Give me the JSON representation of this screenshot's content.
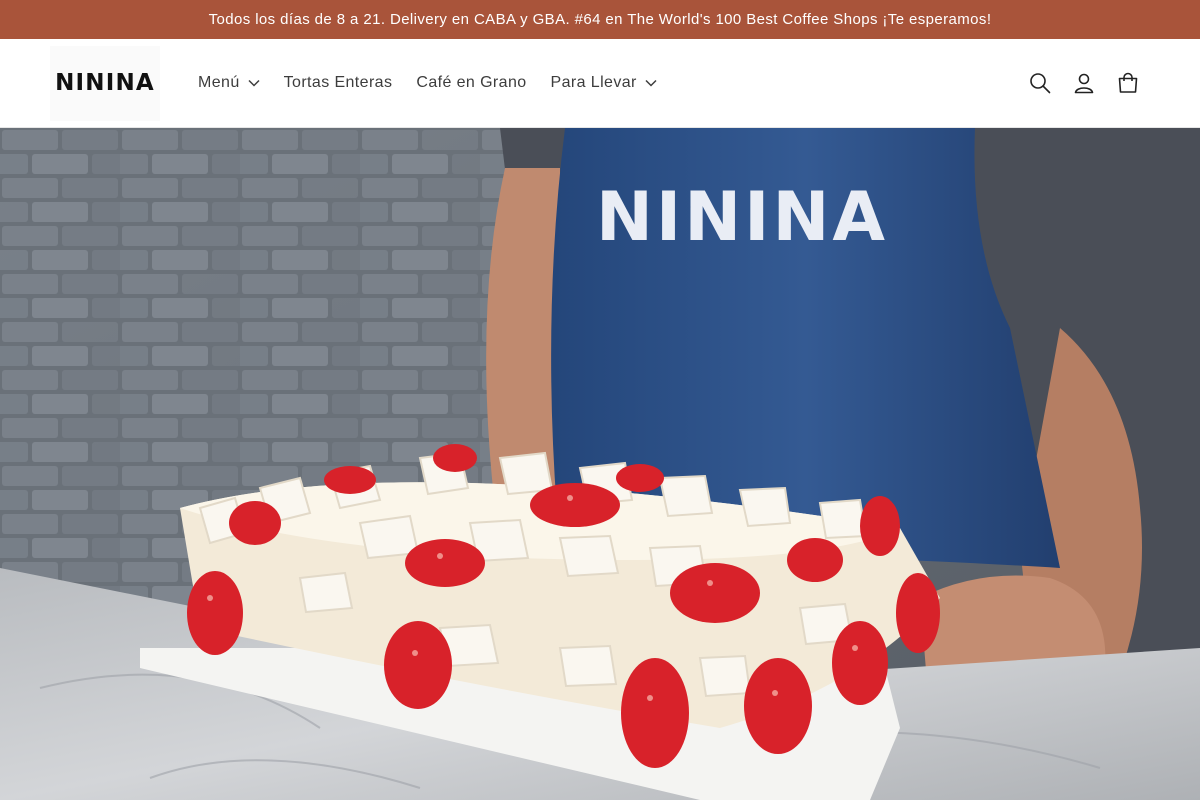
{
  "announcement": {
    "text": "Todos los días de 8 a 21. Delivery en CABA y GBA. #64 en The World's 100 Best Coffee Shops ¡Te esperamos!"
  },
  "header": {
    "logo_text": "NININA",
    "nav": [
      {
        "label": "Menú",
        "has_dropdown": true
      },
      {
        "label": "Tortas Enteras",
        "has_dropdown": false
      },
      {
        "label": "Café en Grano",
        "has_dropdown": false
      },
      {
        "label": "Para Llevar",
        "has_dropdown": true
      }
    ],
    "icons": [
      "search-icon",
      "account-icon",
      "cart-icon"
    ]
  },
  "hero": {
    "apron_text": "NININA"
  },
  "colors": {
    "announcement_bg": "#a9543a",
    "announcement_text": "#ffffff",
    "nav_text": "#3d3d3d",
    "apron": "#2f4f86"
  }
}
